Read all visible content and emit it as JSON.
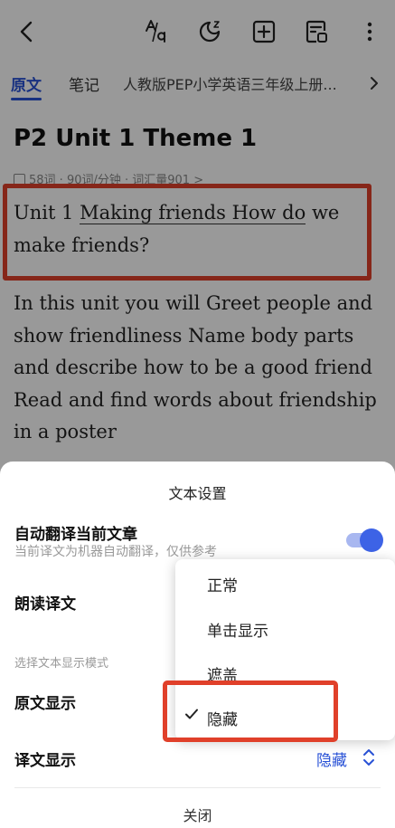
{
  "toolbar": {
    "back_icon": "back-arrow-icon",
    "font_icon": "font-size-icon",
    "theme_icon": "theme-icon",
    "add_icon": "add-icon",
    "vocab_icon": "vocab-list-icon",
    "more_icon": "more-vertical-icon"
  },
  "tabs": {
    "original": "原文",
    "notes": "笔记",
    "book": "人教版PEP小学英语三年级上册..."
  },
  "article": {
    "title": "P2 Unit 1 Theme 1",
    "meta": "58词 · 90词/分钟 · 词汇量901 >",
    "p1_prefix": "Unit 1 ",
    "p1_underlined": "Making friends How do",
    "p1_suffix": " we make friends?",
    "p2": "In this unit you will Greet people and show friendliness Name body parts and describe how to be a good friend Read and find words about friendship in a poster"
  },
  "sheet": {
    "title": "文本设置",
    "auto_translate_label": "自动翻译当前文章",
    "auto_translate_note": "当前译文为机器自动翻译，仅供参考",
    "auto_translate_on": true,
    "read_translation_label": "朗读译文",
    "mode_section_label": "选择文本显示模式",
    "original_display_label": "原文显示",
    "translation_display_label": "译文显示",
    "translation_display_value": "隐藏",
    "close_label": "关闭"
  },
  "dropdown": {
    "options": [
      "正常",
      "单击显示",
      "遮盖",
      "隐藏"
    ],
    "selected": "隐藏"
  },
  "colors": {
    "accent": "#2952d6",
    "highlight": "#e0402a"
  }
}
